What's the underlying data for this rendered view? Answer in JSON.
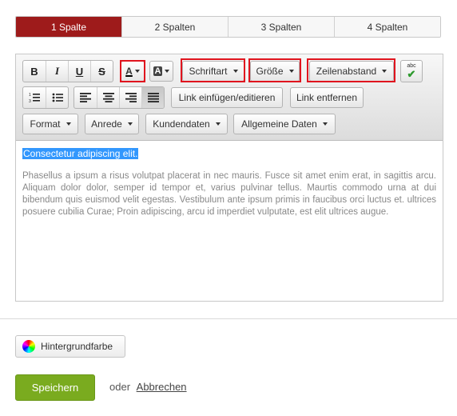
{
  "tabs": [
    "1 Spalte",
    "2 Spalten",
    "3 Spalten",
    "4 Spalten"
  ],
  "active_tab": "1 Spalte",
  "toolbar": {
    "bold": "B",
    "italic": "I",
    "underline": "U",
    "strike": "S",
    "font_color": "A",
    "bg_color": "A",
    "font": "Schriftart",
    "size": "Größe",
    "line_height": "Zeilenabstand",
    "spell": "abc",
    "link_insert": "Link einfügen/editieren",
    "link_remove": "Link entfernen",
    "format": "Format",
    "salutation": "Anrede",
    "customer_data": "Kundendaten",
    "general_data": "Allgemeine Daten"
  },
  "content": {
    "selected": "Consectetur adipiscing elit.",
    "paragraph": "Phasellus a ipsum a risus volutpat placerat in nec mauris. Fusce sit amet enim erat, in sagittis arcu. Aliquam dolor dolor, semper id tempor et, varius pulvinar tellus. Maurtis commodo urna at dui bibendum quis euismod velit egestas. Vestibulum ante ipsum primis in faucibus orci luctus et. ultrices posuere cubilia Curae; Proin adipiscing, arcu id imperdiet vulputate, est elit ultrices augue."
  },
  "footer": {
    "background_color": "Hintergrundfarbe",
    "save": "Speichern",
    "or": "oder",
    "cancel": "Abbrechen"
  },
  "colors": {
    "active_tab": "#9e1b1b",
    "save": "#7aab1f",
    "highlight": "#e0141e",
    "selection": "#3297fd"
  }
}
